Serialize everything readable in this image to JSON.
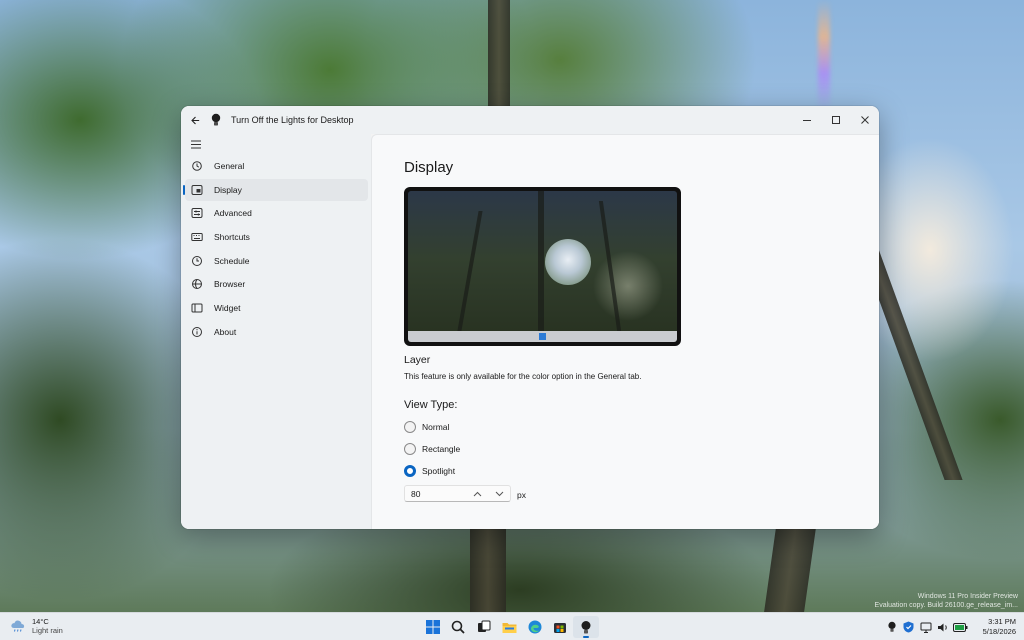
{
  "window": {
    "title": "Turn Off the Lights for Desktop",
    "back_icon": "back-arrow-icon",
    "minimize_icon": "minimize-icon",
    "maximize_icon": "maximize-icon",
    "close_icon": "close-icon"
  },
  "sidebar": {
    "menu_icon": "hamburger-icon",
    "items": [
      {
        "label": "General",
        "icon": "gear-icon",
        "active": false
      },
      {
        "label": "Display",
        "icon": "display-icon",
        "active": true
      },
      {
        "label": "Advanced",
        "icon": "sliders-icon",
        "active": false
      },
      {
        "label": "Shortcuts",
        "icon": "keyboard-icon",
        "active": false
      },
      {
        "label": "Schedule",
        "icon": "clock-icon",
        "active": false
      },
      {
        "label": "Browser",
        "icon": "browser-icon",
        "active": false
      },
      {
        "label": "Widget",
        "icon": "widget-icon",
        "active": false
      },
      {
        "label": "About",
        "icon": "info-icon",
        "active": false
      }
    ]
  },
  "main": {
    "title": "Display",
    "layer_title": "Layer",
    "layer_description": "This feature is only available for the color option in the General tab.",
    "view_type_label": "View Type:",
    "view_types": [
      {
        "label": "Normal",
        "checked": false
      },
      {
        "label": "Rectangle",
        "checked": false
      },
      {
        "label": "Spotlight",
        "checked": true
      }
    ],
    "spotlight_size": "80",
    "spotlight_unit": "px"
  },
  "watermark": {
    "line1": "Windows 11 Pro Insider Preview",
    "line2": "Evaluation copy. Build 26100.ge_release_im..."
  },
  "taskbar": {
    "weather_temp": "14°C",
    "weather_condition": "Light rain",
    "apps": [
      "start-icon",
      "search-icon",
      "task-view-icon",
      "file-explorer-icon",
      "edge-icon",
      "store-icon",
      "turn-off-the-lights-icon"
    ],
    "tray": [
      "turn-off-the-lights-tray-icon",
      "security-icon",
      "network-icon",
      "volume-icon",
      "battery-icon"
    ],
    "time": "3:31 PM",
    "date": "5/18/2026"
  },
  "colors": {
    "accent": "#0a65c2",
    "window_bg": "#f3f3f3",
    "content_bg": "#f8f9fa",
    "taskbar_bg": "#e9edf1"
  }
}
